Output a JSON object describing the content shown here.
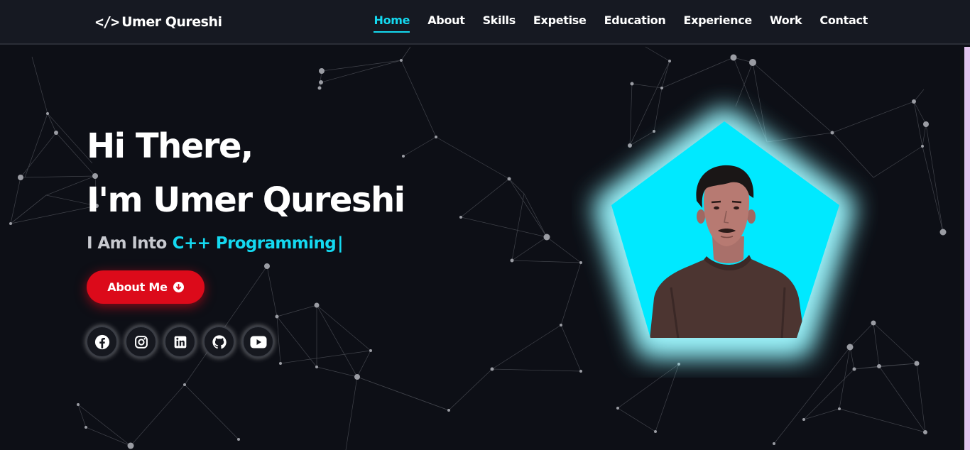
{
  "navbar": {
    "logo_glyph": "</>",
    "logo_text": "Umer Qureshi",
    "links": [
      {
        "label": "Home",
        "active": true
      },
      {
        "label": "About",
        "active": false
      },
      {
        "label": "Skills",
        "active": false
      },
      {
        "label": "Expetise",
        "active": false
      },
      {
        "label": "Education",
        "active": false
      },
      {
        "label": "Experience",
        "active": false
      },
      {
        "label": "Work",
        "active": false
      },
      {
        "label": "Contact",
        "active": false
      }
    ]
  },
  "hero": {
    "greeting": "Hi There,",
    "name_line": "I'm Umer Qureshi",
    "typing_prefix": "I Am Into",
    "typing_word": "C++ Programming",
    "typing_cursor": "|",
    "button_label": "About Me"
  },
  "socials": [
    {
      "icon": "facebook-icon"
    },
    {
      "icon": "instagram-icon"
    },
    {
      "icon": "linkedin-icon"
    },
    {
      "icon": "github-icon"
    },
    {
      "icon": "youtube-icon"
    }
  ],
  "colors": {
    "background": "#0d0f16",
    "navbar": "#161922",
    "accent": "#14d9f0",
    "button": "#dc0a1a",
    "pentagon": "#00e9ff"
  }
}
